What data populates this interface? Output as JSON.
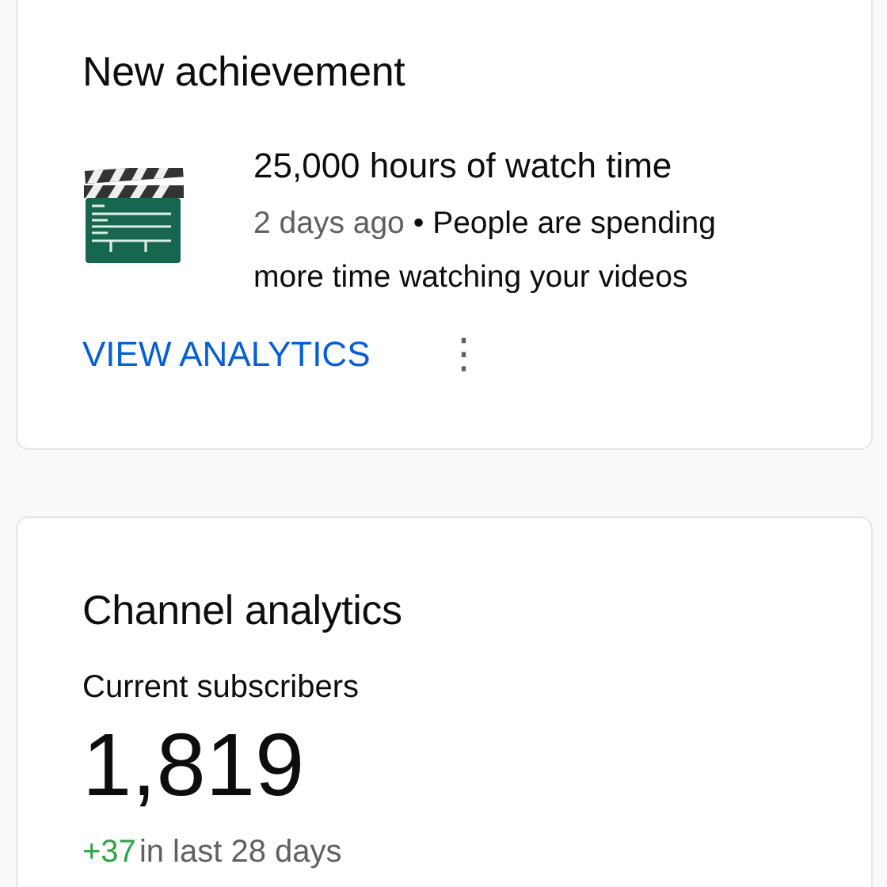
{
  "achievement_card": {
    "title": "New achievement",
    "achievement": {
      "title": "25,000 hours of watch time",
      "time": "2 days ago",
      "separator": "•",
      "description": "People are spending more time watching your videos"
    },
    "action": "VIEW ANALYTICS",
    "more_menu": "⋮"
  },
  "analytics_card": {
    "title": "Channel analytics",
    "metric_label": "Current subscribers",
    "metric_value": "1,819",
    "change": "+37",
    "change_period": "in last 28 days"
  }
}
